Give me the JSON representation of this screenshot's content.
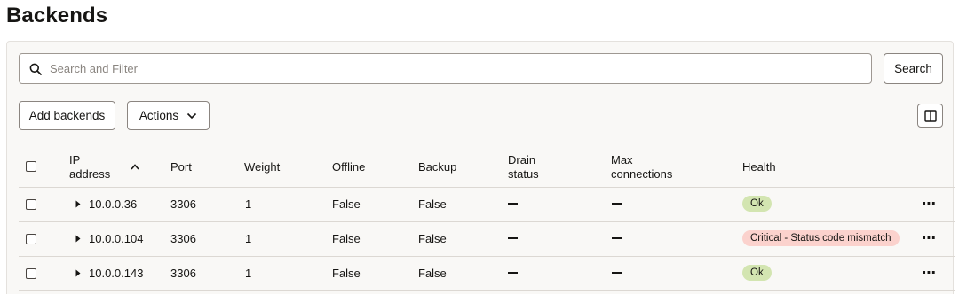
{
  "page": {
    "title": "Backends"
  },
  "toolbar": {
    "search_placeholder": "Search and Filter",
    "search_label": "Search",
    "add_label": "Add backends",
    "actions_label": "Actions"
  },
  "table": {
    "headers": {
      "ip_line1": "IP",
      "ip_line2": "address",
      "port": "Port",
      "weight": "Weight",
      "offline": "Offline",
      "backup": "Backup",
      "drain_line1": "Drain",
      "drain_line2": "status",
      "max_line1": "Max",
      "max_line2": "connections",
      "health": "Health"
    },
    "rows": [
      {
        "ip": "10.0.0.36",
        "port": "3306",
        "weight": "1",
        "offline": "False",
        "backup": "False",
        "health": "Ok",
        "status": "ok"
      },
      {
        "ip": "10.0.0.104",
        "port": "3306",
        "weight": "1",
        "offline": "False",
        "backup": "False",
        "health": "Critical - Status code mismatch",
        "status": "critical"
      },
      {
        "ip": "10.0.0.143",
        "port": "3306",
        "weight": "1",
        "offline": "False",
        "backup": "False",
        "health": "Ok",
        "status": "ok"
      }
    ]
  },
  "colors": {
    "ok_badge": "#d3e5b1",
    "critical_badge": "#fbd2cd"
  }
}
